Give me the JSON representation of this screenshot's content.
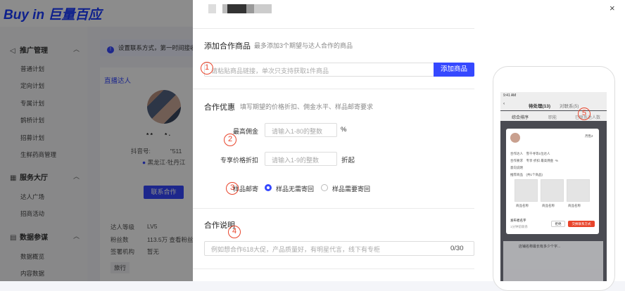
{
  "app": {
    "logo": "Buy in 巨量百应"
  },
  "sidebar": {
    "sections": [
      {
        "icon": "megaphone-icon",
        "glyph": "◁",
        "label": "推广管理",
        "items": [
          "普通计划",
          "定向计划",
          "专属计划",
          "鹊桥计划",
          "招募计划",
          "生鲜药商管理"
        ]
      },
      {
        "icon": "store-icon",
        "glyph": "▦",
        "label": "服务大厅",
        "items": [
          "达人广场",
          "招商活动"
        ]
      },
      {
        "icon": "chart-icon",
        "glyph": "▤",
        "label": "数据参谋",
        "items": [
          "数据概览",
          "内容数据"
        ]
      }
    ]
  },
  "background": {
    "notice": "设置联系方式，第一时间接收合",
    "tab": "直播达人",
    "name_masked": "* *　　*  ·",
    "douyin_id": "抖音号:　　　 \"511",
    "location": "黑龙江·牡丹江",
    "contact_button": "联系合作",
    "stats": [
      {
        "key": "达人等级",
        "value": "LV5"
      },
      {
        "key": "粉丝数",
        "value": "113.5万  查看粉丝"
      },
      {
        "key": "签署机构",
        "value": "暂无"
      }
    ],
    "tag": "旅行"
  },
  "drawer": {
    "close_label": "×",
    "product": {
      "title": "添加合作商品",
      "subtitle": "最多添加3个期望与达人合作的商品",
      "input_placeholder": "请粘贴商品链接，单次只支持获取1件商品",
      "add_button": "添加商品"
    },
    "offer": {
      "title": "合作优惠",
      "subtitle": "填写期望的价格折扣、佣金水平、样品邮寄要求",
      "commission_label": "最高佣金",
      "commission_placeholder": "请输入1-80的整数",
      "commission_unit": "%",
      "discount_label": "专享价格折扣",
      "discount_placeholder": "请输入1-9的整数",
      "discount_unit": "折起",
      "sample_label": "样品邮寄",
      "sample_options": [
        {
          "label": "样品无需寄回",
          "selected": true
        },
        {
          "label": "样品需要寄回",
          "selected": false
        }
      ]
    },
    "notes": {
      "title": "合作说明",
      "placeholder": "例如想合作618大促，产品质量好，有明星代言，线下有专柜",
      "counter": "0/30"
    },
    "markers": [
      "1",
      "2",
      "3",
      "4",
      "5"
    ]
  },
  "phone": {
    "status_time": "9:41 AM",
    "tabs": [
      "待处理(13)",
      "对联系(5)"
    ],
    "subtabs": [
      "综合排序",
      "职能",
      "已联系达人数"
    ],
    "card_meta": "月售2",
    "rows": [
      "合作达人　雪千寻等1位达人",
      "合作要求　专享·折扣 最高佣金 ·%",
      "意向说明",
      "推荐商品　(共1个商品)"
    ],
    "images": [
      "商品名称",
      "商品名称",
      "商品名称"
    ],
    "poster": "发布者名字",
    "poster_time": "1分钟前联系",
    "reject_button": "拒绝",
    "accept_button": "交换联系方式",
    "list_title": "店铺名称最长有多少个字..."
  }
}
